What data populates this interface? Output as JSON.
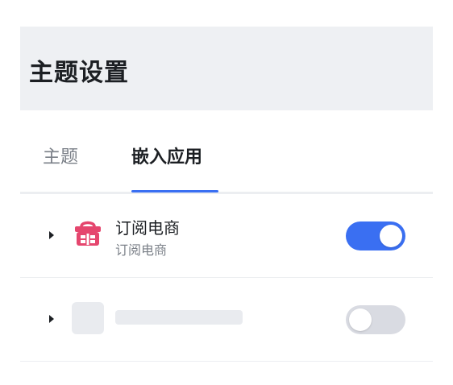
{
  "header": {
    "title": "主题设置"
  },
  "tabs": [
    {
      "label": "主题",
      "active": false
    },
    {
      "label": "嵌入应用",
      "active": true
    }
  ],
  "apps": [
    {
      "name": "订阅电商",
      "description": "订阅电商",
      "icon": "shopping-basket-icon",
      "enabled": true
    },
    {
      "name": "",
      "description": "",
      "icon": "placeholder-icon",
      "enabled": false,
      "loading": true
    }
  ],
  "colors": {
    "accent": "#3a6ff2",
    "header_bg": "#eef0f3",
    "icon_pink": "#e5466e",
    "toggle_off": "#d9dbe2",
    "skeleton": "#e9ebef"
  }
}
